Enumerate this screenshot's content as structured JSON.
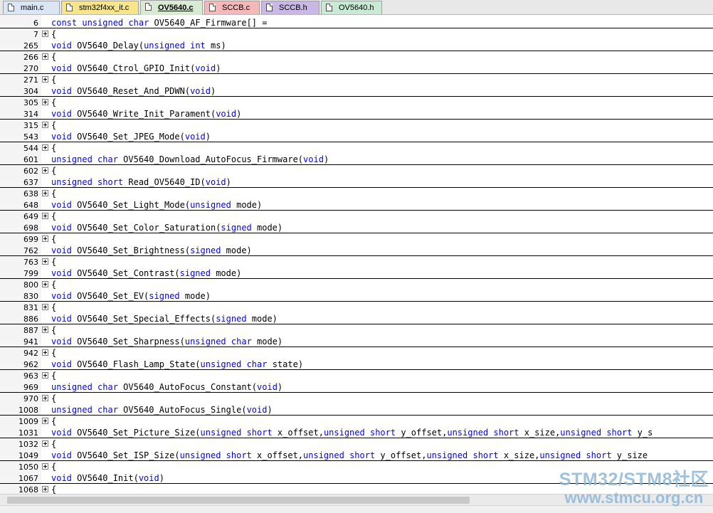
{
  "tabs": [
    {
      "label": "main.c",
      "color": "#dbe6f4",
      "icon": "c-file-icon"
    },
    {
      "label": "stm32f4xx_it.c",
      "color": "#f6e58a",
      "icon": "c-file-icon"
    },
    {
      "label": "OV5640.c",
      "color": "#d9ead2",
      "icon": "c-file-icon",
      "active": true
    },
    {
      "label": "SCCB.c",
      "color": "#f4b8b8",
      "icon": "c-file-icon"
    },
    {
      "label": "SCCB.h",
      "color": "#c9b8e6",
      "icon": "h-file-icon"
    },
    {
      "label": "OV5640.h",
      "color": "#c8ead4",
      "icon": "h-file-icon"
    }
  ],
  "lines": [
    {
      "num": "6",
      "tokens": [
        [
          "const",
          1
        ],
        [
          " ",
          0
        ],
        [
          "unsigned",
          1
        ],
        [
          " ",
          0
        ],
        [
          "char",
          1
        ],
        [
          " OV5640_AF_Firmware[] =",
          0
        ]
      ]
    },
    {
      "num": "7",
      "fold": true,
      "tokens": [
        [
          "{",
          0
        ]
      ]
    },
    {
      "num": "265",
      "tokens": [
        [
          "void",
          1
        ],
        [
          " OV5640_Delay(",
          0
        ],
        [
          "unsigned",
          1
        ],
        [
          " ",
          0
        ],
        [
          "int",
          1
        ],
        [
          " ms)",
          0
        ]
      ]
    },
    {
      "num": "266",
      "fold": true,
      "tokens": [
        [
          "{",
          0
        ]
      ]
    },
    {
      "num": "270",
      "tokens": [
        [
          "void",
          1
        ],
        [
          " OV5640_Ctrol_GPIO_Init(",
          0
        ],
        [
          "void",
          1
        ],
        [
          ")",
          0
        ]
      ]
    },
    {
      "num": "271",
      "fold": true,
      "tokens": [
        [
          "{",
          0
        ]
      ]
    },
    {
      "num": "304",
      "tokens": [
        [
          "void",
          1
        ],
        [
          " OV5640_Reset_And_PDWN(",
          0
        ],
        [
          "void",
          1
        ],
        [
          ")",
          0
        ]
      ]
    },
    {
      "num": "305",
      "fold": true,
      "tokens": [
        [
          "{",
          0
        ]
      ]
    },
    {
      "num": "314",
      "tokens": [
        [
          "void",
          1
        ],
        [
          " OV5640_Write_Init_Parament(",
          0
        ],
        [
          "void",
          1
        ],
        [
          ")",
          0
        ]
      ]
    },
    {
      "num": "315",
      "fold": true,
      "tokens": [
        [
          "{",
          0
        ]
      ]
    },
    {
      "num": "543",
      "tokens": [
        [
          "void",
          1
        ],
        [
          " OV5640_Set_JPEG_Mode(",
          0
        ],
        [
          "void",
          1
        ],
        [
          ")",
          0
        ]
      ]
    },
    {
      "num": "544",
      "fold": true,
      "tokens": [
        [
          "{",
          0
        ]
      ]
    },
    {
      "num": "601",
      "tokens": [
        [
          "unsigned",
          1
        ],
        [
          " ",
          0
        ],
        [
          "char",
          1
        ],
        [
          " OV5640_Download_AutoFocus_Firmware(",
          0
        ],
        [
          "void",
          1
        ],
        [
          ")",
          0
        ]
      ]
    },
    {
      "num": "602",
      "fold": true,
      "tokens": [
        [
          "{",
          0
        ]
      ]
    },
    {
      "num": "637",
      "tokens": [
        [
          "unsigned",
          1
        ],
        [
          " ",
          0
        ],
        [
          "short",
          1
        ],
        [
          " Read_OV5640_ID(",
          0
        ],
        [
          "void",
          1
        ],
        [
          ")",
          0
        ]
      ]
    },
    {
      "num": "638",
      "fold": true,
      "tokens": [
        [
          "{",
          0
        ]
      ]
    },
    {
      "num": "648",
      "tokens": [
        [
          "void",
          1
        ],
        [
          " OV5640_Set_Light_Mode(",
          0
        ],
        [
          "unsigned",
          1
        ],
        [
          " mode)",
          0
        ]
      ]
    },
    {
      "num": "649",
      "fold": true,
      "tokens": [
        [
          "{",
          0
        ]
      ]
    },
    {
      "num": "698",
      "tokens": [
        [
          "void",
          1
        ],
        [
          " OV5640_Set_Color_Saturation(",
          0
        ],
        [
          "signed",
          1
        ],
        [
          " mode)",
          0
        ]
      ]
    },
    {
      "num": "699",
      "fold": true,
      "tokens": [
        [
          "{",
          0
        ]
      ]
    },
    {
      "num": "762",
      "tokens": [
        [
          "void",
          1
        ],
        [
          " OV5640_Set_Brightness(",
          0
        ],
        [
          "signed",
          1
        ],
        [
          " mode)",
          0
        ]
      ]
    },
    {
      "num": "763",
      "fold": true,
      "tokens": [
        [
          "{",
          0
        ]
      ]
    },
    {
      "num": "799",
      "tokens": [
        [
          "void",
          1
        ],
        [
          " OV5640_Set_Contrast(",
          0
        ],
        [
          "signed",
          1
        ],
        [
          " mode)",
          0
        ]
      ]
    },
    {
      "num": "800",
      "fold": true,
      "tokens": [
        [
          "{",
          0
        ]
      ]
    },
    {
      "num": "830",
      "tokens": [
        [
          "void",
          1
        ],
        [
          " OV5640_Set_EV(",
          0
        ],
        [
          "signed",
          1
        ],
        [
          " mode)",
          0
        ]
      ]
    },
    {
      "num": "831",
      "fold": true,
      "tokens": [
        [
          "{",
          0
        ]
      ]
    },
    {
      "num": "886",
      "tokens": [
        [
          "void",
          1
        ],
        [
          " OV5640_Set_Special_Effects(",
          0
        ],
        [
          "signed",
          1
        ],
        [
          " mode)",
          0
        ]
      ]
    },
    {
      "num": "887",
      "fold": true,
      "tokens": [
        [
          "{",
          0
        ]
      ]
    },
    {
      "num": "941",
      "tokens": [
        [
          "void",
          1
        ],
        [
          " OV5640_Set_Sharpness(",
          0
        ],
        [
          "unsigned",
          1
        ],
        [
          " ",
          0
        ],
        [
          "char",
          1
        ],
        [
          " mode)",
          0
        ]
      ]
    },
    {
      "num": "942",
      "fold": true,
      "tokens": [
        [
          "{",
          0
        ]
      ]
    },
    {
      "num": "962",
      "tokens": [
        [
          "void",
          1
        ],
        [
          " OV5640_Flash_Lamp_State(",
          0
        ],
        [
          "unsigned",
          1
        ],
        [
          " ",
          0
        ],
        [
          "char",
          1
        ],
        [
          " state)",
          0
        ]
      ]
    },
    {
      "num": "963",
      "fold": true,
      "tokens": [
        [
          "{",
          0
        ]
      ]
    },
    {
      "num": "969",
      "tokens": [
        [
          "unsigned",
          1
        ],
        [
          " ",
          0
        ],
        [
          "char",
          1
        ],
        [
          " OV5640_AutoFocus_Constant(",
          0
        ],
        [
          "void",
          1
        ],
        [
          ")",
          0
        ]
      ]
    },
    {
      "num": "970",
      "fold": true,
      "tokens": [
        [
          "{",
          0
        ]
      ]
    },
    {
      "num": "1008",
      "tokens": [
        [
          "unsigned",
          1
        ],
        [
          " ",
          0
        ],
        [
          "char",
          1
        ],
        [
          " OV5640_AutoFocus_Single(",
          0
        ],
        [
          "void",
          1
        ],
        [
          ")",
          0
        ]
      ]
    },
    {
      "num": "1009",
      "fold": true,
      "tokens": [
        [
          "{",
          0
        ]
      ]
    },
    {
      "num": "1031",
      "tokens": [
        [
          "void",
          1
        ],
        [
          " OV5640_Set_Picture_Size(",
          0
        ],
        [
          "unsigned",
          1
        ],
        [
          " ",
          0
        ],
        [
          "short",
          1
        ],
        [
          " x_offset,",
          0
        ],
        [
          "unsigned",
          1
        ],
        [
          " ",
          0
        ],
        [
          "short",
          1
        ],
        [
          " y_offset,",
          0
        ],
        [
          "unsigned",
          1
        ],
        [
          " ",
          0
        ],
        [
          "short",
          1
        ],
        [
          " x_size,",
          0
        ],
        [
          "unsigned",
          1
        ],
        [
          " ",
          0
        ],
        [
          "short",
          1
        ],
        [
          " y_s",
          0
        ]
      ]
    },
    {
      "num": "1032",
      "fold": true,
      "tokens": [
        [
          "{",
          0
        ]
      ]
    },
    {
      "num": "1049",
      "tokens": [
        [
          "void",
          1
        ],
        [
          " OV5640_Set_ISP_Size(",
          0
        ],
        [
          "unsigned",
          1
        ],
        [
          " ",
          0
        ],
        [
          "short",
          1
        ],
        [
          " x_offset,",
          0
        ],
        [
          "unsigned",
          1
        ],
        [
          " ",
          0
        ],
        [
          "short",
          1
        ],
        [
          " y_offset,",
          0
        ],
        [
          "unsigned",
          1
        ],
        [
          " ",
          0
        ],
        [
          "short",
          1
        ],
        [
          " x_size,",
          0
        ],
        [
          "unsigned",
          1
        ],
        [
          " ",
          0
        ],
        [
          "short",
          1
        ],
        [
          " y_size",
          0
        ]
      ]
    },
    {
      "num": "1050",
      "fold": true,
      "tokens": [
        [
          "{",
          0
        ]
      ]
    },
    {
      "num": "1067",
      "tokens": [
        [
          "void",
          1
        ],
        [
          " OV5640_Init(",
          0
        ],
        [
          "void",
          1
        ],
        [
          ")",
          0
        ]
      ]
    },
    {
      "num": "1068",
      "fold": true,
      "tokens": [
        [
          "{",
          0
        ]
      ]
    }
  ],
  "watermark": {
    "line1": "STM32/STM8社区",
    "line2": "www.stmcu.org.cn"
  }
}
